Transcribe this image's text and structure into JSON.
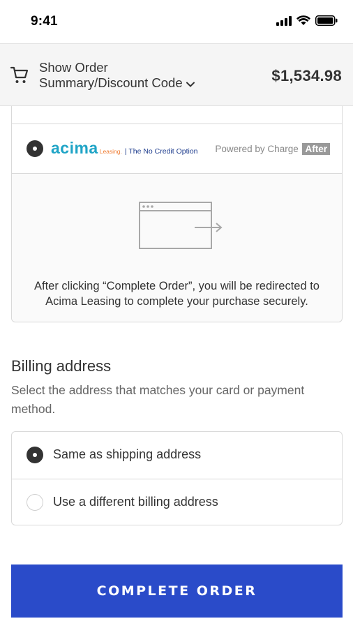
{
  "status_bar": {
    "time": "9:41"
  },
  "order_summary": {
    "toggle_label_line1": "Show Order",
    "toggle_label_line2": "Summary/Discount Code",
    "total": "$1,534.98"
  },
  "payment": {
    "acima": {
      "logo_word": "acima",
      "logo_leasing": "Leasing.",
      "logo_tagline": "| The No Credit Option",
      "powered_by": "Powered by Charge",
      "powered_by_badge": "After"
    },
    "redirect_message": "After clicking “Complete Order”, you will be redirected to Acima Leasing to complete your purchase securely."
  },
  "billing": {
    "title": "Billing address",
    "subtitle": "Select the address that matches your card or payment method.",
    "options": [
      {
        "label": "Same as shipping address",
        "selected": true
      },
      {
        "label": "Use a different billing address",
        "selected": false
      }
    ]
  },
  "actions": {
    "complete_order": "COMPLETE ORDER"
  },
  "colors": {
    "primary_button": "#2a4bc9",
    "acima_blue": "#1fa4c6",
    "acima_orange": "#ef7c33"
  },
  "icons": [
    "signal-icon",
    "wifi-icon",
    "battery-icon",
    "cart-icon",
    "chevron-down-icon",
    "redirect-window-icon"
  ]
}
